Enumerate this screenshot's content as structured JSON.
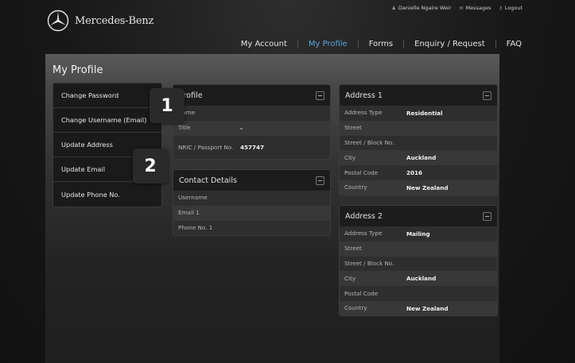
{
  "brand": {
    "name": "Mercedes-Benz"
  },
  "util_nav": {
    "user": "Danielle Ngaire Weir",
    "messages": "Messages",
    "logout": "Logout"
  },
  "main_nav": [
    {
      "label": "My Account",
      "active": false
    },
    {
      "label": "My Profile",
      "active": true
    },
    {
      "label": "Forms",
      "active": false
    },
    {
      "label": "Enquiry / Request",
      "active": false
    },
    {
      "label": "FAQ",
      "active": false
    }
  ],
  "page": {
    "title": "My Profile"
  },
  "sidebar": [
    "Change Password",
    "Change Username (Email)",
    "Update Address",
    "Update Email",
    "Update Phone No."
  ],
  "callouts": [
    "1",
    "2"
  ],
  "profile": {
    "title": "Profile",
    "rows": [
      {
        "label": "Name",
        "value": ""
      },
      {
        "label": "Title",
        "value": "-"
      },
      {
        "label": "NRIC / Passport No.",
        "value": "457747"
      }
    ]
  },
  "contact": {
    "title": "Contact Details",
    "rows": [
      {
        "label": "Username",
        "value": ""
      },
      {
        "label": "Email 1",
        "value": ""
      },
      {
        "label": "Phone No. 1",
        "value": ""
      }
    ]
  },
  "address1": {
    "title": "Address 1",
    "rows": [
      {
        "label": "Address Type",
        "value": "Residential"
      },
      {
        "label": "Street",
        "value": ""
      },
      {
        "label": "Street / Block No.",
        "value": ""
      },
      {
        "label": "City",
        "value": "Auckland"
      },
      {
        "label": "Postal Code",
        "value": "2016"
      },
      {
        "label": "Country",
        "value": "New Zealand"
      }
    ]
  },
  "address2": {
    "title": "Address 2",
    "rows": [
      {
        "label": "Address Type",
        "value": "Mailing"
      },
      {
        "label": "Street",
        "value": ""
      },
      {
        "label": "Street / Block No.",
        "value": ""
      },
      {
        "label": "City",
        "value": "Auckland"
      },
      {
        "label": "Postal Code",
        "value": ""
      },
      {
        "label": "Country",
        "value": "New Zealand"
      }
    ]
  },
  "colors": {
    "accent": "#5aa3d8"
  }
}
